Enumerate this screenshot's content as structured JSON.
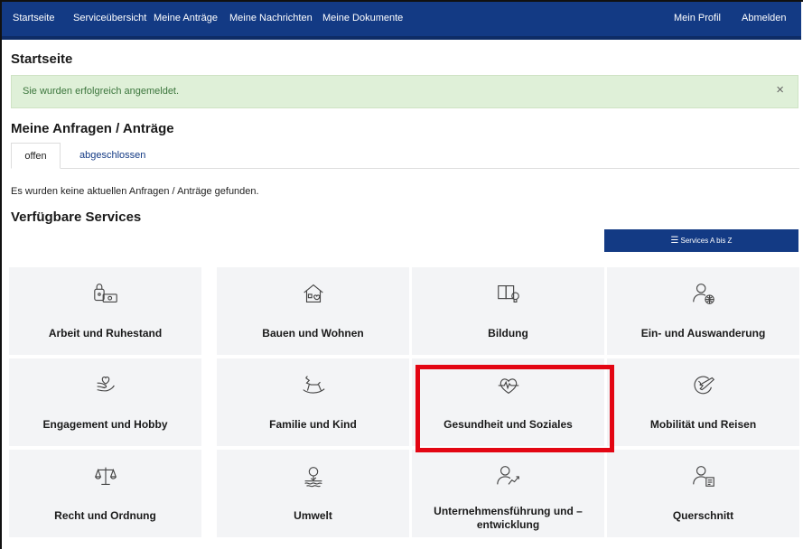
{
  "nav": {
    "left": [
      "Startseite",
      "Serviceübersicht",
      "Meine Anträge",
      "Meine Nachrichten",
      "Meine Dokumente"
    ],
    "right": [
      "Mein Profil",
      "Abmelden"
    ]
  },
  "page_title": "Startseite",
  "alert": {
    "message": "Sie wurden erfolgreich angemeldet.",
    "close": "×"
  },
  "requests": {
    "heading": "Meine Anfragen / Anträge",
    "tabs": [
      "offen",
      "abgeschlossen"
    ],
    "empty_message": "Es wurden keine aktuellen Anfragen / Anträge gefunden."
  },
  "services": {
    "heading": "Verfügbare Services",
    "az_button": "Services A bis Z",
    "tiles": [
      {
        "label": "Arbeit und Ruhestand",
        "icon": "lock-money-icon"
      },
      {
        "label": "Bauen und Wohnen",
        "icon": "house-heart-icon"
      },
      {
        "label": "Bildung",
        "icon": "book-lightbulb-icon"
      },
      {
        "label": "Ein- und Auswanderung",
        "icon": "person-globe-icon"
      },
      {
        "label": "Engagement und Hobby",
        "icon": "hand-heart-icon"
      },
      {
        "label": "Familie und Kind",
        "icon": "rocking-horse-icon"
      },
      {
        "label": "Gesundheit und Soziales",
        "icon": "heart-pulse-icon"
      },
      {
        "label": "Mobilität und Reisen",
        "icon": "globe-plane-icon"
      },
      {
        "label": "Recht und Ordnung",
        "icon": "scales-icon"
      },
      {
        "label": "Umwelt",
        "icon": "tree-water-icon"
      },
      {
        "label": "Unternehmensführung und –entwicklung",
        "icon": "person-growth-icon"
      },
      {
        "label": "Querschnitt",
        "icon": "person-document-icon"
      }
    ]
  },
  "colors": {
    "nav": "#133a84",
    "alert_bg": "#dff0d8",
    "alert_text": "#3c763d",
    "tile_bg": "#f3f4f6",
    "highlight": "#e30613"
  }
}
